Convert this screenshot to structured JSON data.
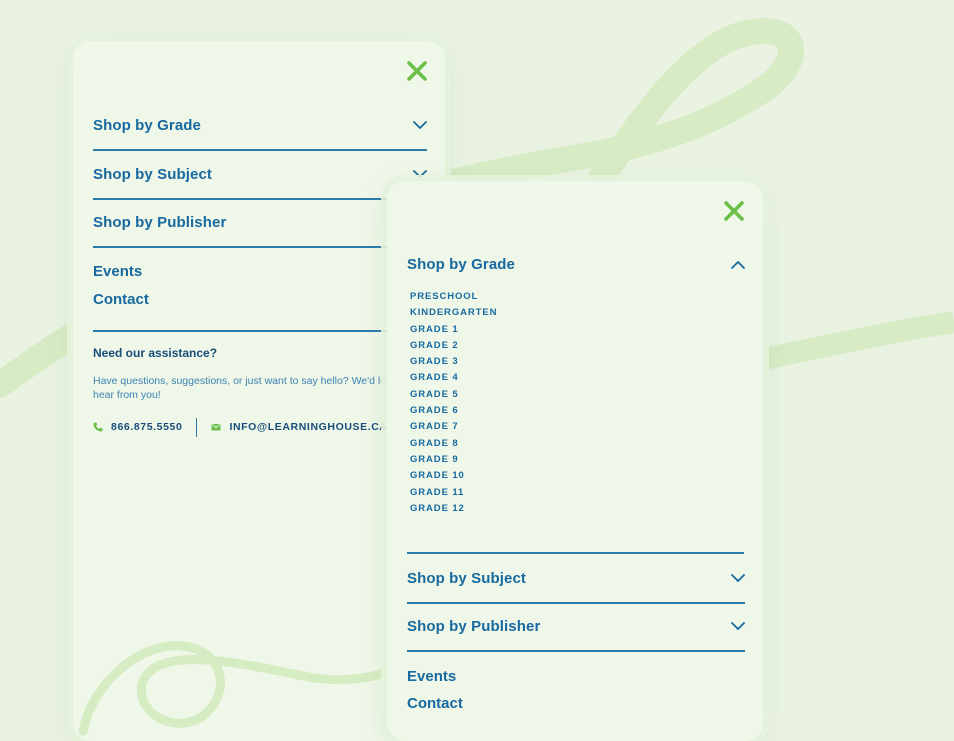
{
  "colors": {
    "background": "#eaf3e2",
    "panel": "#eff7e9",
    "primary_blue": "#17699f",
    "divider": "#2c7aa7",
    "accent_green": "#6cc04a",
    "swirl": "#d3eabf"
  },
  "icons": {
    "close": "close-x-icon",
    "expand": "chevron-down-icon",
    "collapse": "chevron-up-icon",
    "phone": "phone-icon",
    "email": "envelope-icon"
  },
  "menu_collapsed": {
    "nav": [
      {
        "label": "Shop by Grade"
      },
      {
        "label": "Shop by Subject"
      },
      {
        "label": "Shop by Publisher"
      }
    ],
    "links": [
      {
        "label": "Events"
      },
      {
        "label": "Contact"
      }
    ],
    "assistance": {
      "title": "Need our assistance?",
      "text": "Have questions, suggestions, or just want to say hello? We'd love to hear from you!",
      "phone": "866.875.5550",
      "email": "INFO@LEARNINGHOUSE.CA"
    }
  },
  "menu_expanded": {
    "open_section": {
      "label": "Shop by Grade",
      "items": [
        "PRESCHOOL",
        "KINDERGARTEN",
        "GRADE 1",
        "GRADE 2",
        "GRADE 3",
        "GRADE 4",
        "GRADE 5",
        "GRADE 6",
        "GRADE 7",
        "GRADE 8",
        "GRADE 9",
        "GRADE 10",
        "GRADE 11",
        "GRADE 12"
      ]
    },
    "nav": [
      {
        "label": "Shop by Subject"
      },
      {
        "label": "Shop by Publisher"
      }
    ],
    "links": [
      {
        "label": "Events"
      },
      {
        "label": "Contact"
      }
    ]
  }
}
